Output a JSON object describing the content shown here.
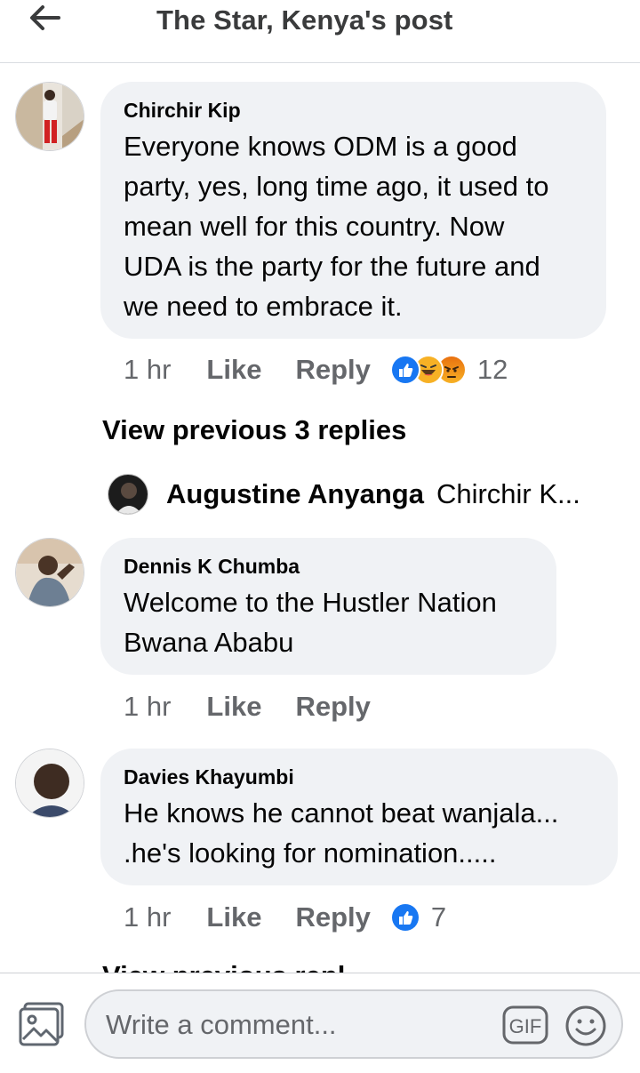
{
  "header": {
    "title": "The Star, Kenya's post"
  },
  "comments": [
    {
      "author": "Chirchir Kip",
      "text": "Everyone knows ODM is a  good\nparty, yes, long time ago, it used to\nmean well for this country. Now\nUDA is the party for the future and\nwe need to embrace it.",
      "time": "1 hr",
      "like_label": "Like",
      "reply_label": "Reply",
      "reactions": [
        "like",
        "haha",
        "angry"
      ],
      "reaction_count": "12"
    },
    {
      "author": "Dennis K Chumba",
      "text": "Welcome to the Hustler Nation\nBwana Ababu",
      "time": "1 hr",
      "like_label": "Like",
      "reply_label": "Reply"
    },
    {
      "author": "Davies Khayumbi",
      "text": "He knows he cannot beat wanjala...\n.he's looking for nomination.....",
      "time": "1 hr",
      "like_label": "Like",
      "reply_label": "Reply",
      "reactions": [
        "like"
      ],
      "reaction_count": "7"
    }
  ],
  "view_previous": "View previous 3 replies",
  "reply_preview": {
    "author": "Augustine Anyanga",
    "text": "Chirchir K..."
  },
  "cutoff_text": "View previous repl",
  "composer": {
    "placeholder": "Write a comment...",
    "gif_label": "GIF"
  },
  "colors": {
    "bubble": "#f0f2f5",
    "like_blue": "#1877f2",
    "muted": "#65676b",
    "haha_yellow": "#f7b125",
    "angry_orange": "#e9710f"
  }
}
